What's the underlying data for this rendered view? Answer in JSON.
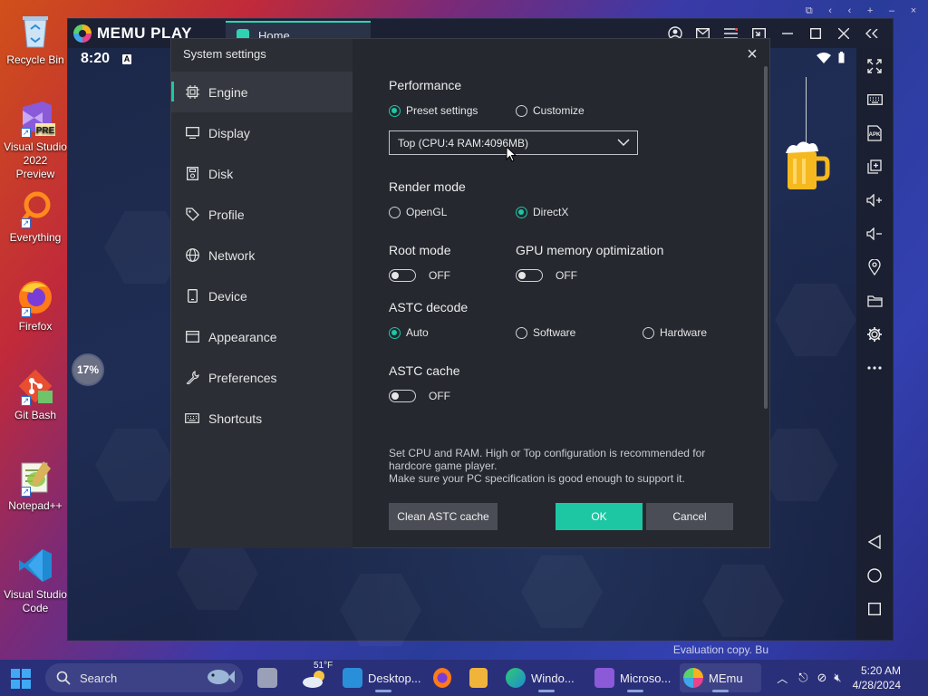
{
  "desktop": {
    "icons": [
      {
        "label": "Recycle Bin"
      },
      {
        "label": "Visual Studio 2022 Preview"
      },
      {
        "label": "Everything"
      },
      {
        "label": "Firefox"
      },
      {
        "label": "Git Bash"
      },
      {
        "label": "Notepad++"
      },
      {
        "label": "Visual Studio Code"
      }
    ],
    "evaluation_text": "Evaluation copy. Bu"
  },
  "memu": {
    "logo_text": "MEMU PLAY",
    "home_tab_label": "Home",
    "android_clock": "8:20",
    "progress_percent": "17%"
  },
  "dialog": {
    "title": "System settings",
    "nav": [
      {
        "label": "Engine",
        "active": true
      },
      {
        "label": "Display"
      },
      {
        "label": "Disk"
      },
      {
        "label": "Profile"
      },
      {
        "label": "Network"
      },
      {
        "label": "Device"
      },
      {
        "label": "Appearance"
      },
      {
        "label": "Preferences"
      },
      {
        "label": "Shortcuts"
      }
    ],
    "performance": {
      "title": "Performance",
      "preset_label": "Preset settings",
      "customize_label": "Customize",
      "selected": "Preset settings",
      "dropdown_value": "Top (CPU:4 RAM:4096MB)"
    },
    "render_mode": {
      "title": "Render mode",
      "opengl_label": "OpenGL",
      "directx_label": "DirectX",
      "selected": "DirectX"
    },
    "root_mode": {
      "title": "Root mode",
      "state": "OFF"
    },
    "gpu_memory": {
      "title": "GPU memory optimization",
      "state": "OFF"
    },
    "astc_decode": {
      "title": "ASTC decode",
      "auto_label": "Auto",
      "software_label": "Software",
      "hardware_label": "Hardware",
      "selected": "Auto"
    },
    "astc_cache": {
      "title": "ASTC cache",
      "state": "OFF"
    },
    "hint_line1": "Set CPU and RAM. High or Top configuration is recommended for",
    "hint_line2": "hardcore game player.",
    "hint_line3": "Make sure your PC specification is good enough to support it.",
    "buttons": {
      "clean_cache": "Clean ASTC cache",
      "ok": "OK",
      "cancel": "Cancel"
    }
  },
  "taskbar": {
    "search_placeholder": "Search",
    "weather": "51°F",
    "items": [
      {
        "label": "Desktop..."
      },
      {
        "label": "Windo..."
      },
      {
        "label": "Microso..."
      },
      {
        "label": "MEmu"
      }
    ],
    "time": "5:20 AM",
    "date": "4/28/2024"
  },
  "colors": {
    "accent": "#1dc7a4",
    "dialog_bg": "#25282f",
    "taskbar_bg": "#2a2f7a"
  }
}
